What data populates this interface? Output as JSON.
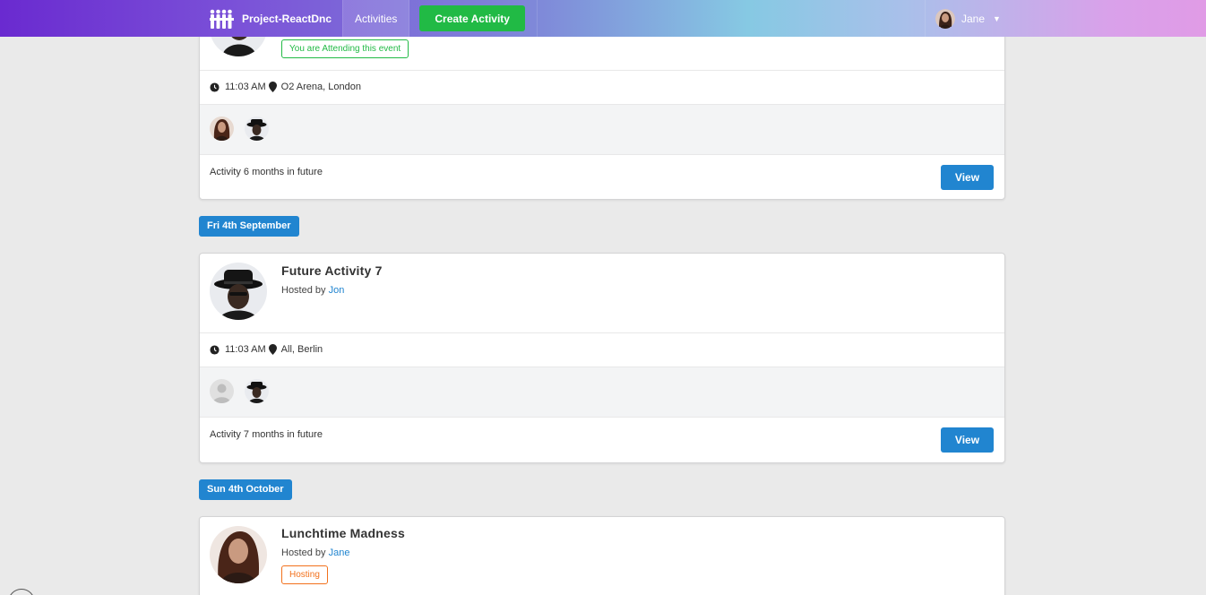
{
  "nav": {
    "brand": "Project-ReactDnc",
    "activities": "Activities",
    "create": "Create Activity",
    "user": "Jane"
  },
  "card1": {
    "attending": "You are Attending this event",
    "time": "11:03 AM",
    "venue": "O2 Arena, London",
    "description": "Activity 6 months in future",
    "view": "View"
  },
  "groups": [
    {
      "date": "Fri 4th September",
      "title": "Future Activity 7",
      "hosted_prefix": "Hosted by",
      "host": "Jon",
      "time": "11:03 AM",
      "venue": "All, Berlin",
      "description": "Activity 7 months in future",
      "view": "View"
    },
    {
      "date": "Sun 4th October",
      "title": "Lunchtime Madness",
      "hosted_prefix": "Hosted by",
      "host": "Jane",
      "badge": "Hosting"
    }
  ],
  "icons": {
    "logo": "logo-icon",
    "time": "clock-icon",
    "venue": "map-marker-icon",
    "caret": "caret-down-icon"
  },
  "colors": {
    "primary": "#2185d0",
    "green": "#21ba45",
    "orange": "#f2711c"
  }
}
